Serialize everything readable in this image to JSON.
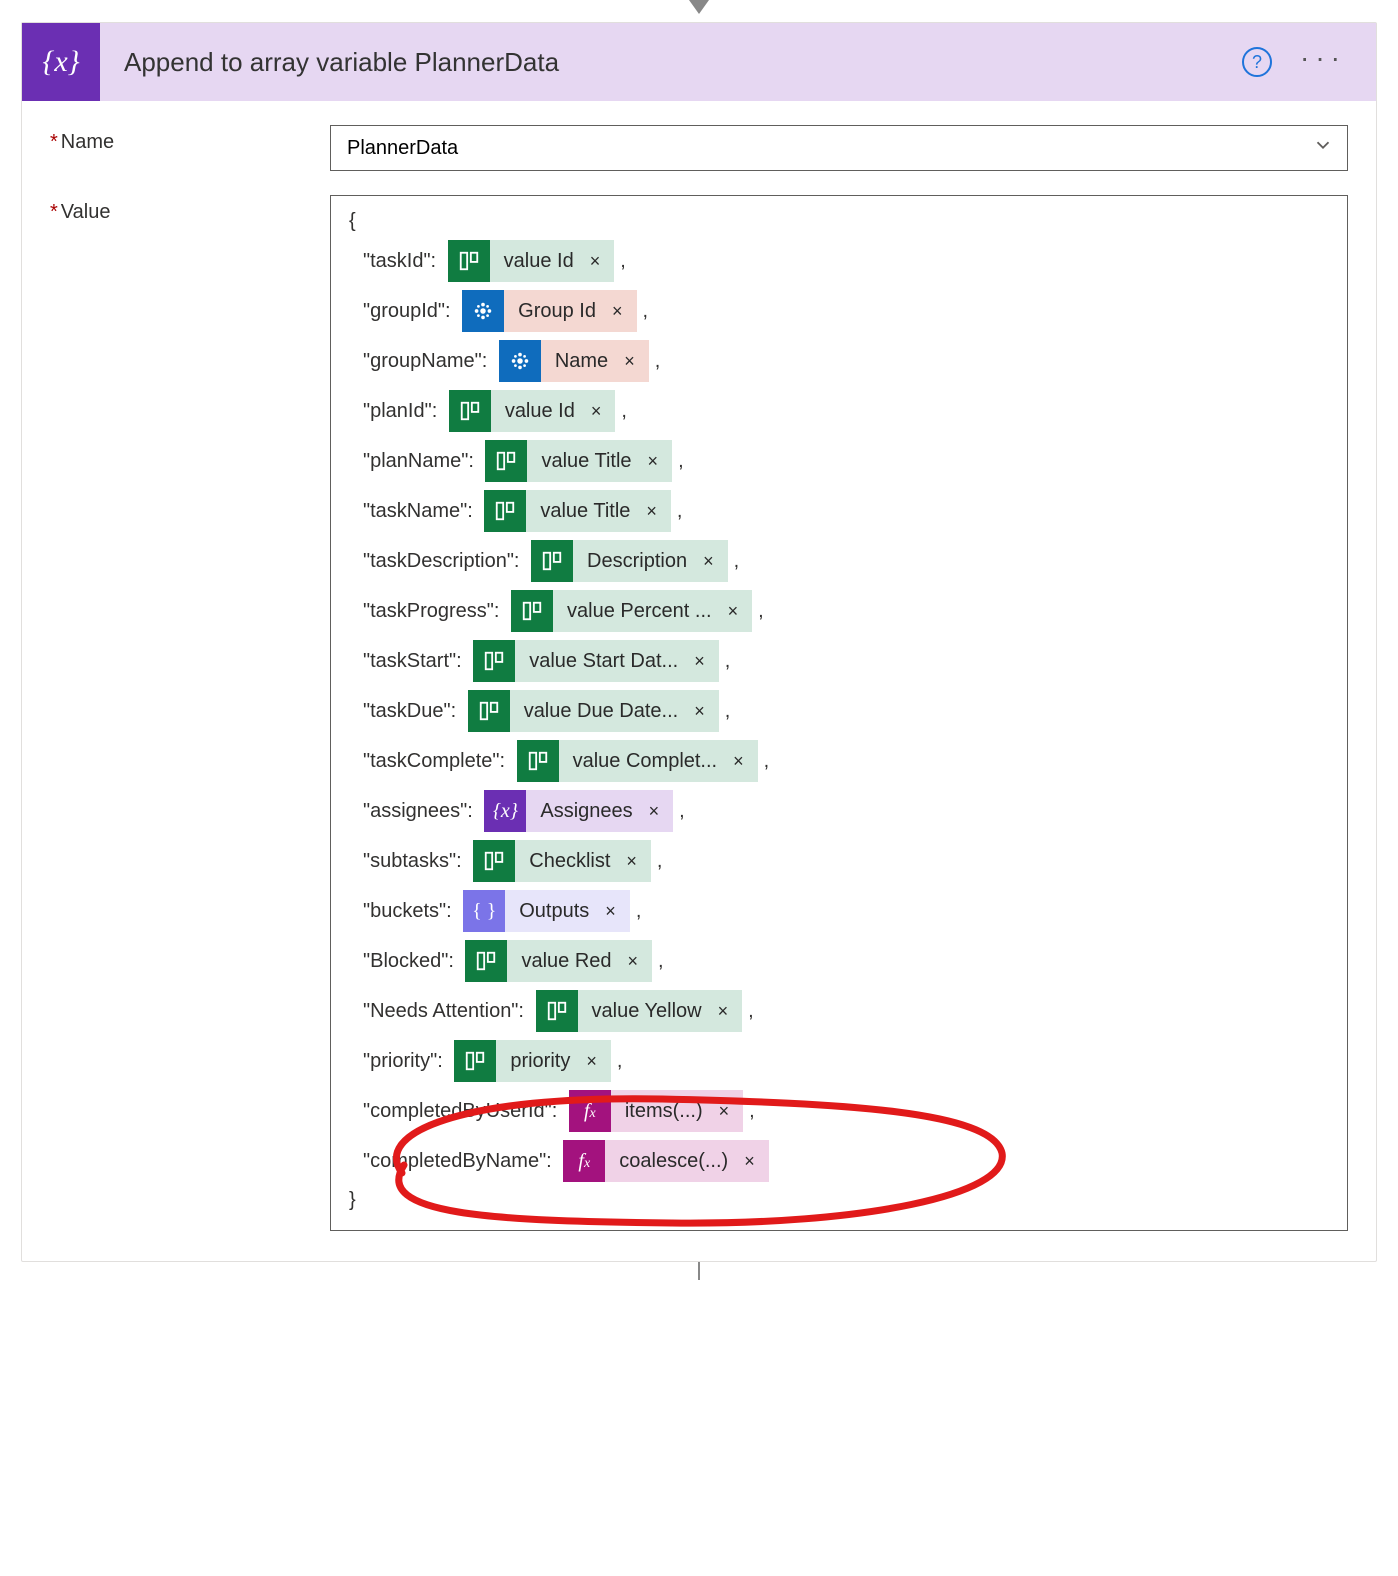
{
  "header": {
    "icon_label": "{x}",
    "title": "Append to array variable PlannerData"
  },
  "fields": {
    "name_label": "Name",
    "value_label": "Value",
    "name_value": "PlannerData"
  },
  "editor": {
    "open_brace": "{",
    "close_brace": "}",
    "rows": [
      {
        "key": "\"taskId\":",
        "token": {
          "scheme": "planner",
          "icon": "planner",
          "label": "value Id"
        }
      },
      {
        "key": "\"groupId\":",
        "token": {
          "scheme": "groups",
          "icon": "groups",
          "label": "Group Id"
        }
      },
      {
        "key": "\"groupName\":",
        "token": {
          "scheme": "groups",
          "icon": "groups",
          "label": "Name"
        }
      },
      {
        "key": "\"planId\":",
        "token": {
          "scheme": "planner",
          "icon": "planner",
          "label": "value Id"
        }
      },
      {
        "key": "\"planName\":",
        "token": {
          "scheme": "planner",
          "icon": "planner",
          "label": "value Title"
        }
      },
      {
        "key": "\"taskName\":",
        "token": {
          "scheme": "planner",
          "icon": "planner",
          "label": "value Title"
        }
      },
      {
        "key": "\"taskDescription\":",
        "token": {
          "scheme": "planner",
          "icon": "planner",
          "label": "Description"
        }
      },
      {
        "key": "\"taskProgress\":",
        "token": {
          "scheme": "planner",
          "icon": "planner",
          "label": "value Percent ..."
        }
      },
      {
        "key": "\"taskStart\":",
        "token": {
          "scheme": "planner",
          "icon": "planner",
          "label": "value Start Dat..."
        }
      },
      {
        "key": "\"taskDue\":",
        "token": {
          "scheme": "planner",
          "icon": "planner",
          "label": "value Due Date..."
        }
      },
      {
        "key": "\"taskComplete\":",
        "token": {
          "scheme": "planner",
          "icon": "planner",
          "label": "value Complet..."
        }
      },
      {
        "key": "\"assignees\":",
        "token": {
          "scheme": "var",
          "icon": "var",
          "label": "Assignees"
        }
      },
      {
        "key": "\"subtasks\":",
        "token": {
          "scheme": "planner",
          "icon": "planner",
          "label": "Checklist"
        }
      },
      {
        "key": "\"buckets\":",
        "token": {
          "scheme": "outputs",
          "icon": "outputs",
          "label": "Outputs"
        }
      },
      {
        "key": "\"Blocked\":",
        "token": {
          "scheme": "planner",
          "icon": "planner",
          "label": "value Red"
        }
      },
      {
        "key": "\"Needs Attention\":",
        "token": {
          "scheme": "planner",
          "icon": "planner",
          "label": "value Yellow"
        }
      },
      {
        "key": "\"priority\":",
        "token": {
          "scheme": "planner",
          "icon": "planner",
          "label": "priority"
        }
      },
      {
        "key": "\"completedByUserId\":",
        "token": {
          "scheme": "fx",
          "icon": "fx",
          "label": "items(...)"
        }
      },
      {
        "key": "\"completedByName\":",
        "token": {
          "scheme": "fx",
          "icon": "fx",
          "label": "coalesce(...)"
        },
        "last": true
      }
    ]
  },
  "annotation": {
    "circle_color": "#e11a1a"
  }
}
